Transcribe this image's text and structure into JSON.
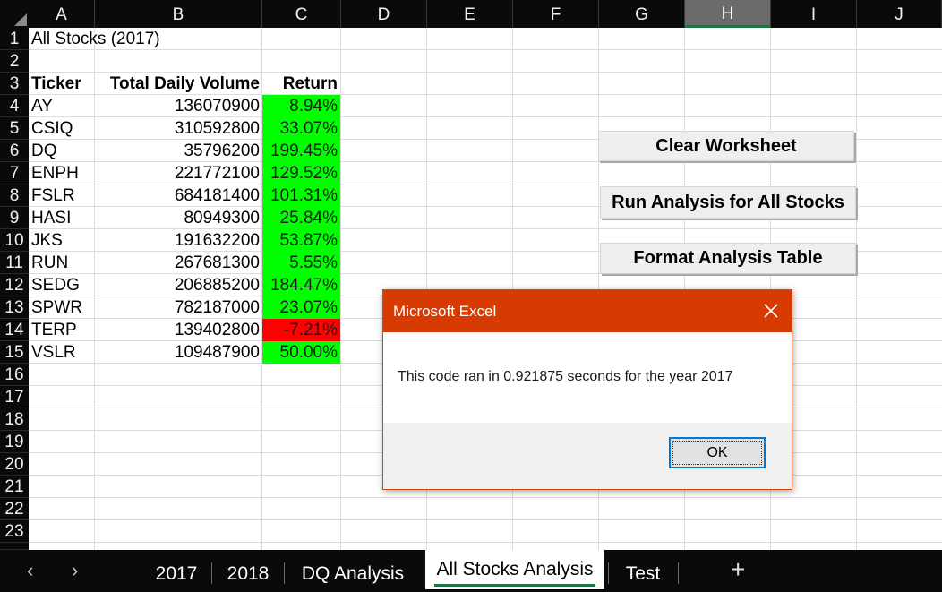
{
  "columns": [
    "A",
    "B",
    "C",
    "D",
    "E",
    "F",
    "G",
    "H",
    "I",
    "J"
  ],
  "selected_column": "H",
  "rows": [
    "1",
    "2",
    "3",
    "4",
    "5",
    "6",
    "7",
    "8",
    "9",
    "10",
    "11",
    "12",
    "13",
    "14",
    "15",
    "16",
    "17",
    "18",
    "19",
    "20",
    "21",
    "22",
    "23"
  ],
  "sheet": {
    "title": "All Stocks (2017)",
    "headers": {
      "ticker": "Ticker",
      "volume": "Total Daily Volume",
      "return": "Return"
    },
    "data": [
      {
        "ticker": "AY",
        "volume": "136070900",
        "return": "8.94%",
        "positive": true
      },
      {
        "ticker": "CSIQ",
        "volume": "310592800",
        "return": "33.07%",
        "positive": true
      },
      {
        "ticker": "DQ",
        "volume": "35796200",
        "return": "199.45%",
        "positive": true
      },
      {
        "ticker": "ENPH",
        "volume": "221772100",
        "return": "129.52%",
        "positive": true
      },
      {
        "ticker": "FSLR",
        "volume": "684181400",
        "return": "101.31%",
        "positive": true
      },
      {
        "ticker": "HASI",
        "volume": "80949300",
        "return": "25.84%",
        "positive": true
      },
      {
        "ticker": "JKS",
        "volume": "191632200",
        "return": "53.87%",
        "positive": true
      },
      {
        "ticker": "RUN",
        "volume": "267681300",
        "return": "5.55%",
        "positive": true
      },
      {
        "ticker": "SEDG",
        "volume": "206885200",
        "return": "184.47%",
        "positive": true
      },
      {
        "ticker": "SPWR",
        "volume": "782187000",
        "return": "23.07%",
        "positive": true
      },
      {
        "ticker": "TERP",
        "volume": "139402800",
        "return": "-7.21%",
        "positive": false
      },
      {
        "ticker": "VSLR",
        "volume": "109487900",
        "return": "50.00%",
        "positive": true
      }
    ]
  },
  "colors": {
    "positive": "#00ff00",
    "negative": "#ff0000",
    "dialog_title": "#d83b01",
    "accent": "#217346"
  },
  "buttons": {
    "clear": "Clear Worksheet",
    "run": "Run Analysis for All Stocks",
    "format": "Format Analysis Table"
  },
  "dialog": {
    "title": "Microsoft Excel",
    "message": "This code ran in 0.921875 seconds for the year 2017",
    "ok": "OK",
    "close_icon": "close-icon"
  },
  "tabs": {
    "prev_icon": "chevron-left-icon",
    "next_icon": "chevron-right-icon",
    "items": [
      "2017",
      "2018",
      "DQ Analysis",
      "All Stocks Analysis",
      "Test"
    ],
    "active": "All Stocks Analysis",
    "add_icon": "plus-icon"
  }
}
